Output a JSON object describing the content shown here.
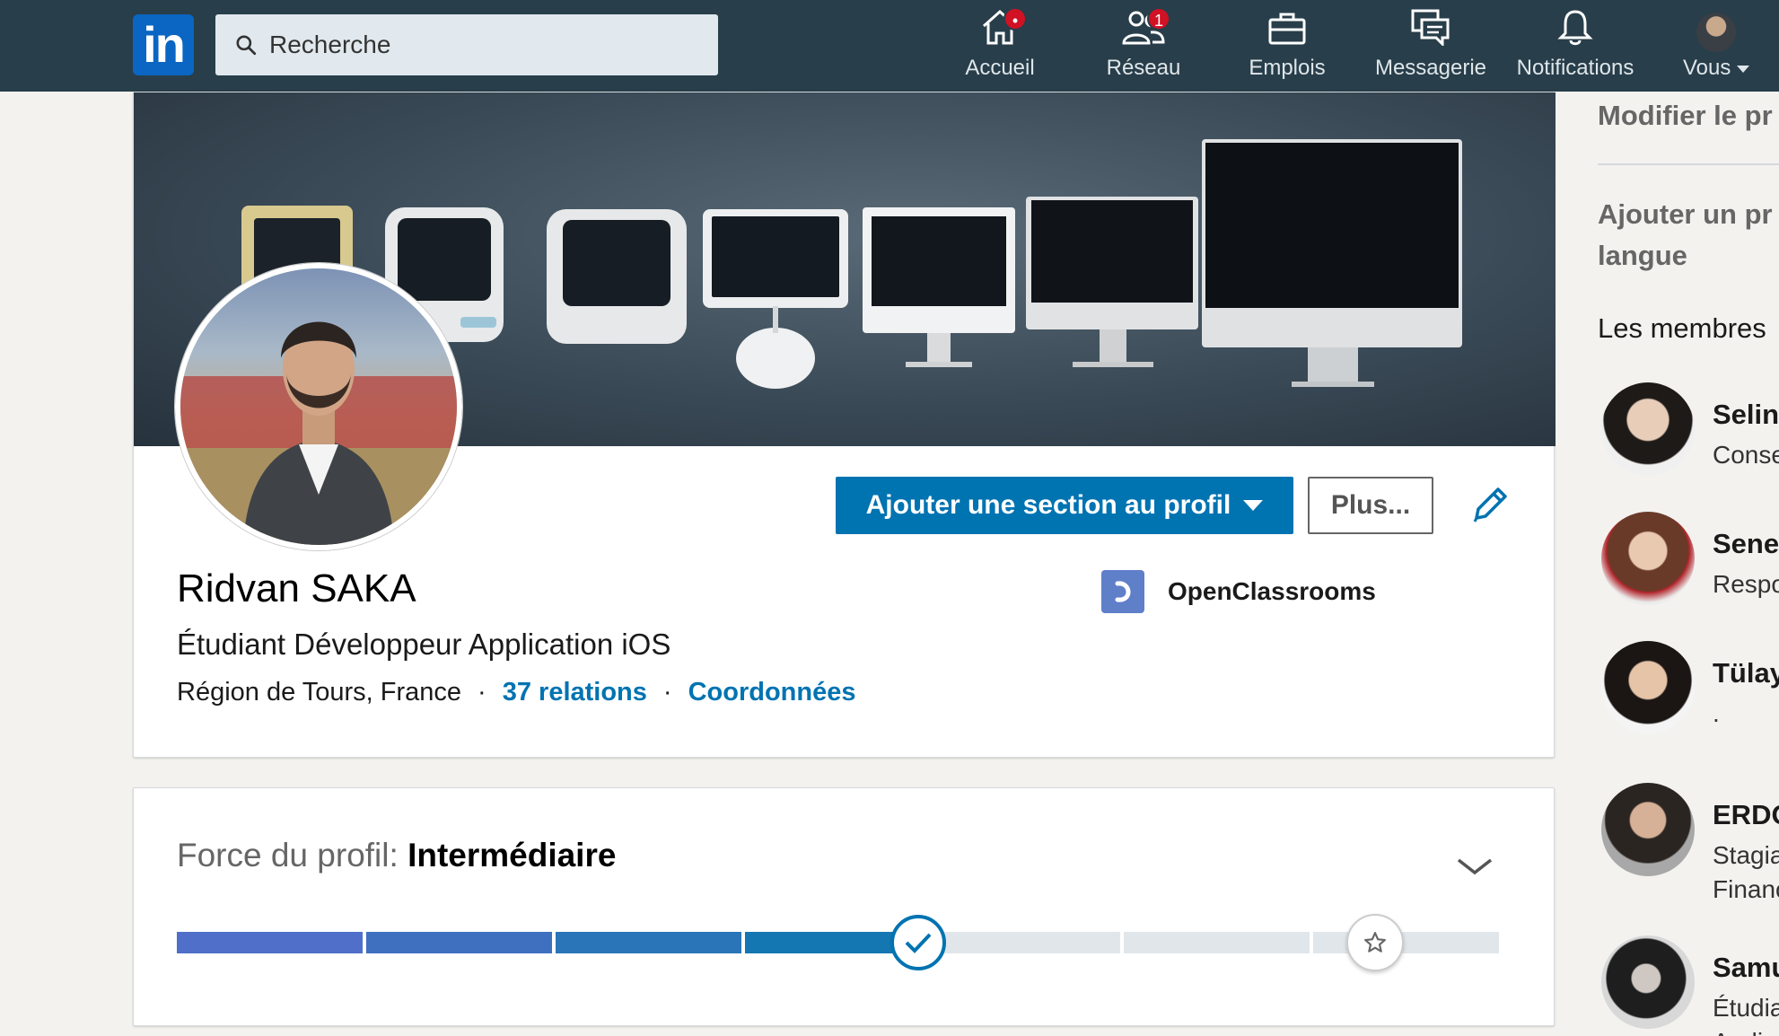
{
  "nav": {
    "logo_text": "in",
    "search_placeholder": "Recherche",
    "items": [
      {
        "label": "Accueil",
        "badge": "•",
        "icon": "home-icon"
      },
      {
        "label": "Réseau",
        "badge": "1",
        "icon": "network-icon"
      },
      {
        "label": "Emplois",
        "icon": "briefcase-icon"
      },
      {
        "label": "Messagerie",
        "icon": "messaging-icon"
      },
      {
        "label": "Notifications",
        "icon": "bell-icon"
      },
      {
        "label": "Vous",
        "icon": "avatar"
      }
    ]
  },
  "profile": {
    "name": "Ridvan SAKA",
    "headline": "Étudiant Développeur Application iOS",
    "location": "Région de Tours, France",
    "separator": "·",
    "connections": "37 relations",
    "contact": "Coordonnées",
    "add_section_label": "Ajouter une section au profil",
    "more_label": "Plus...",
    "school": "OpenClassrooms"
  },
  "strength": {
    "prefix": "Force du profil: ",
    "level": "Intermédiaire",
    "completed_steps": 4,
    "total_steps": 7
  },
  "rail": {
    "edit_profile": "Modifier le pr",
    "add_line1": "Ajouter un pr",
    "add_line2": "langue",
    "members_title": "Les membres",
    "members": [
      {
        "name": "Selin",
        "role": "Conse"
      },
      {
        "name": "Sene",
        "role": "Respo"
      },
      {
        "name": "Tülay",
        "role": "."
      },
      {
        "name": "ERDO",
        "role": "Stagia",
        "role2": "Financ"
      },
      {
        "name": "Samu",
        "role": "Étudia",
        "role2": "Audio"
      }
    ]
  },
  "colors": {
    "nav_bg": "#283e4a",
    "brand": "#0073b1",
    "badge": "#d11124"
  }
}
